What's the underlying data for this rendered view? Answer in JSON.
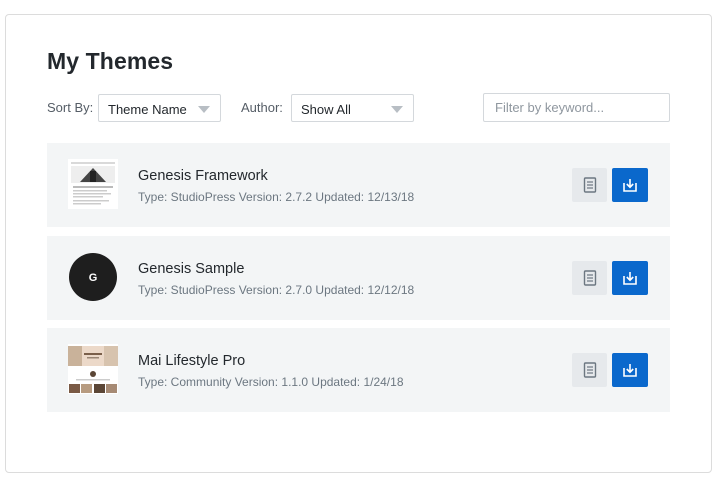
{
  "page": {
    "title": "My Themes"
  },
  "filters": {
    "sort_label": "Sort By:",
    "sort_value": "Theme Name",
    "author_label": "Author:",
    "author_value": "Show All",
    "search_placeholder": "Filter by keyword..."
  },
  "themes": [
    {
      "name": "Genesis Framework",
      "meta": "Type: StudioPress Version: 2.7.2 Updated: 12/13/18",
      "thumb_icon": "genesis-framework-screenshot"
    },
    {
      "name": "Genesis Sample",
      "meta": "Type: StudioPress Version: 2.7.0 Updated: 12/12/18",
      "thumb_icon": "genesis-logo-circle",
      "thumb_letter": "G"
    },
    {
      "name": "Mai Lifestyle Pro",
      "meta": "Type: Community Version: 1.1.0 Updated: 1/24/18",
      "thumb_icon": "mai-lifestyle-screenshot"
    }
  ],
  "actions": {
    "details_icon": "document-icon",
    "download_icon": "download-icon"
  },
  "colors": {
    "accent": "#0a68cc",
    "row_bg": "#f3f5f6",
    "secondary_btn": "#e6e9ec"
  }
}
